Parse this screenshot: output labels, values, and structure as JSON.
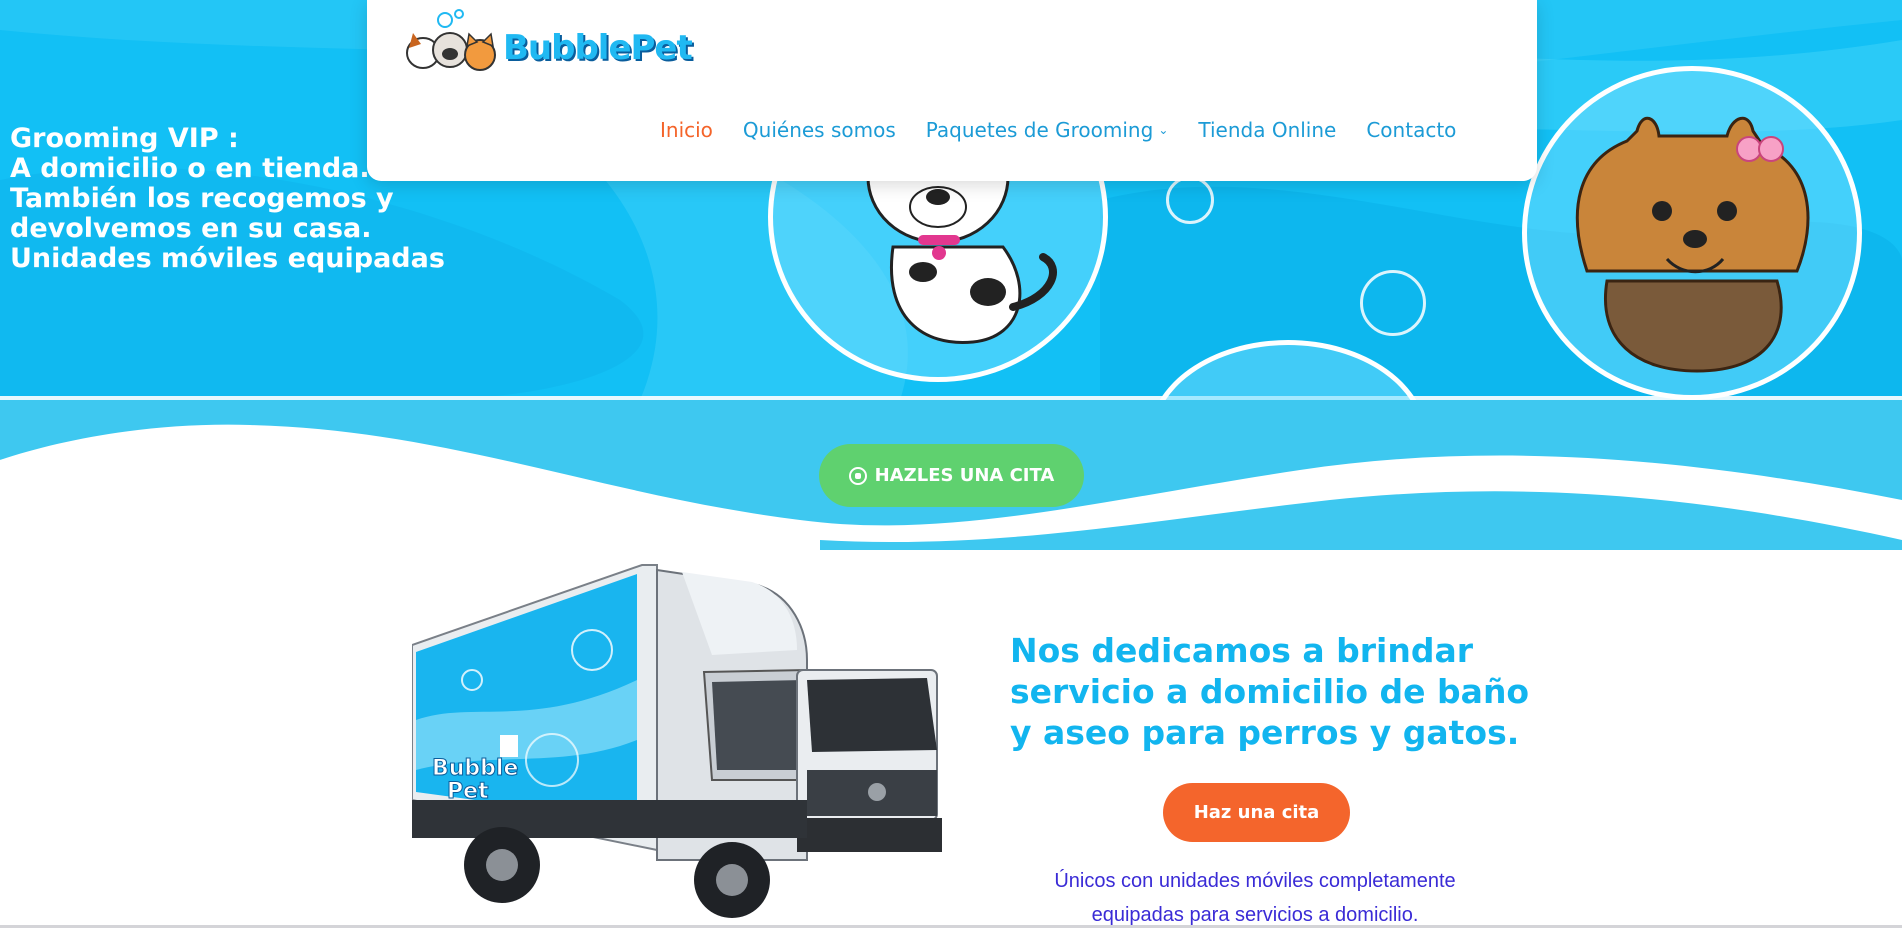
{
  "brand": {
    "name": "BubblePet"
  },
  "nav": {
    "items": [
      {
        "label": "Inicio",
        "active": true
      },
      {
        "label": "Quiénes somos",
        "active": false
      },
      {
        "label": "Paquetes de Grooming",
        "active": false,
        "dropdown": true
      },
      {
        "label": "Tienda Online",
        "active": false
      },
      {
        "label": "Contacto",
        "active": false
      }
    ]
  },
  "hero": {
    "lines": [
      "Grooming VIP :",
      "A domicilio o en tienda.",
      "También los recogemos y",
      "devolvemos en su casa.",
      "Unidades móviles equipadas"
    ]
  },
  "cta": {
    "whatsapp_label": "HAZLES UNA CITA"
  },
  "truck": {
    "brand_top": "Bubble",
    "brand_bottom": "Pet"
  },
  "about": {
    "heading": "Nos dedicamos a brindar servicio a domicilio de baño y aseo para perros y gatos.",
    "button_label": "Haz una cita",
    "description": "Únicos con unidades móviles completamente equipadas para servicios a domicilio."
  },
  "colors": {
    "hero_bg": "#12c0f5",
    "nav_link": "#1c9bd6",
    "nav_active": "#f4642a",
    "whatsapp": "#5fd16f",
    "orange_button": "#f4652c",
    "heading_blue": "#12b5ef",
    "desc_text": "#3a2bd6"
  }
}
